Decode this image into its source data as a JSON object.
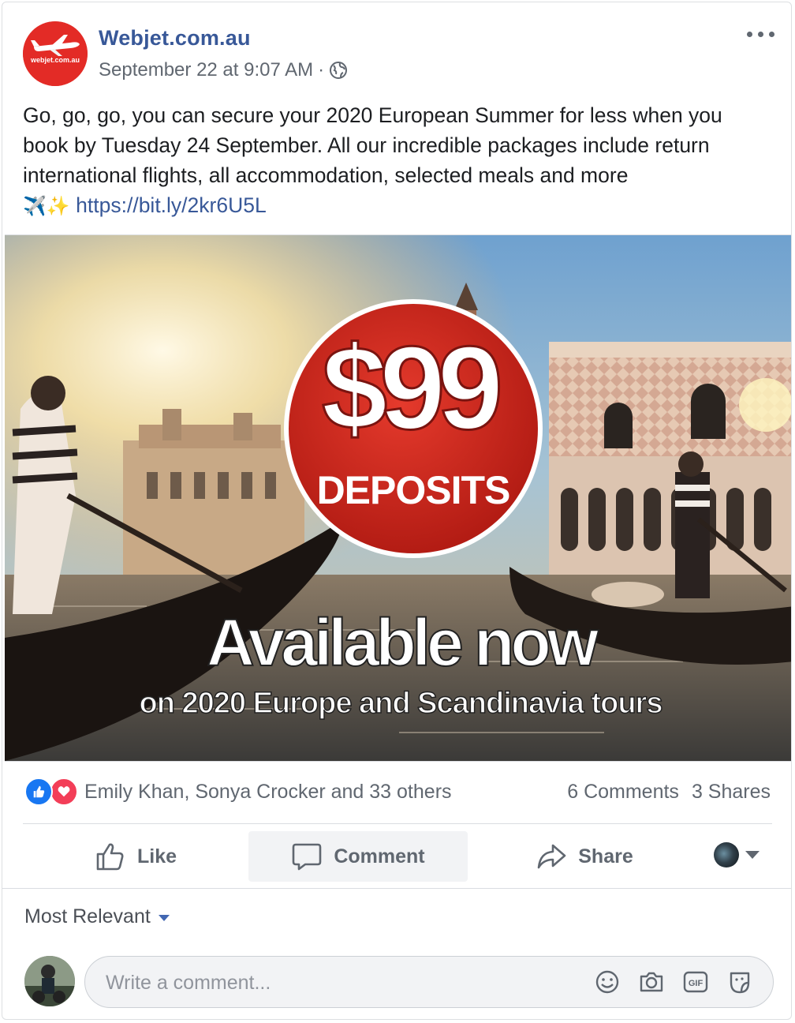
{
  "post": {
    "page_name": "Webjet.com.au",
    "logo_text": "webjet.com.au",
    "timestamp": "September 22 at 9:07 AM",
    "meta_separator": "·",
    "privacy_icon": "globe-icon",
    "text": "Go, go, go, you can secure your 2020 European Summer for less when you book by Tuesday 24 September. All our incredible packages include return international flights, all accommodation, selected meals and more",
    "emoji_plane": "✈️",
    "emoji_sparkles": "✨",
    "link": "https://bit.ly/2kr6U5L"
  },
  "image": {
    "price": "$99",
    "deposits": "DEPOSITS",
    "headline": "Available now",
    "subline": "on 2020 Europe and Scandinavia tours"
  },
  "stats": {
    "reactors": "Emily Khan, Sonya Crocker and 33 others",
    "comments": "6 Comments",
    "shares": "3 Shares"
  },
  "actions": {
    "like": "Like",
    "comment": "Comment",
    "share": "Share"
  },
  "comments_section": {
    "sort_label": "Most Relevant",
    "input_placeholder": "Write a comment..."
  },
  "colors": {
    "brand_blue": "#385898",
    "like_blue": "#1877f2",
    "love_red": "#f33e58",
    "webjet_red": "#e32b26"
  }
}
